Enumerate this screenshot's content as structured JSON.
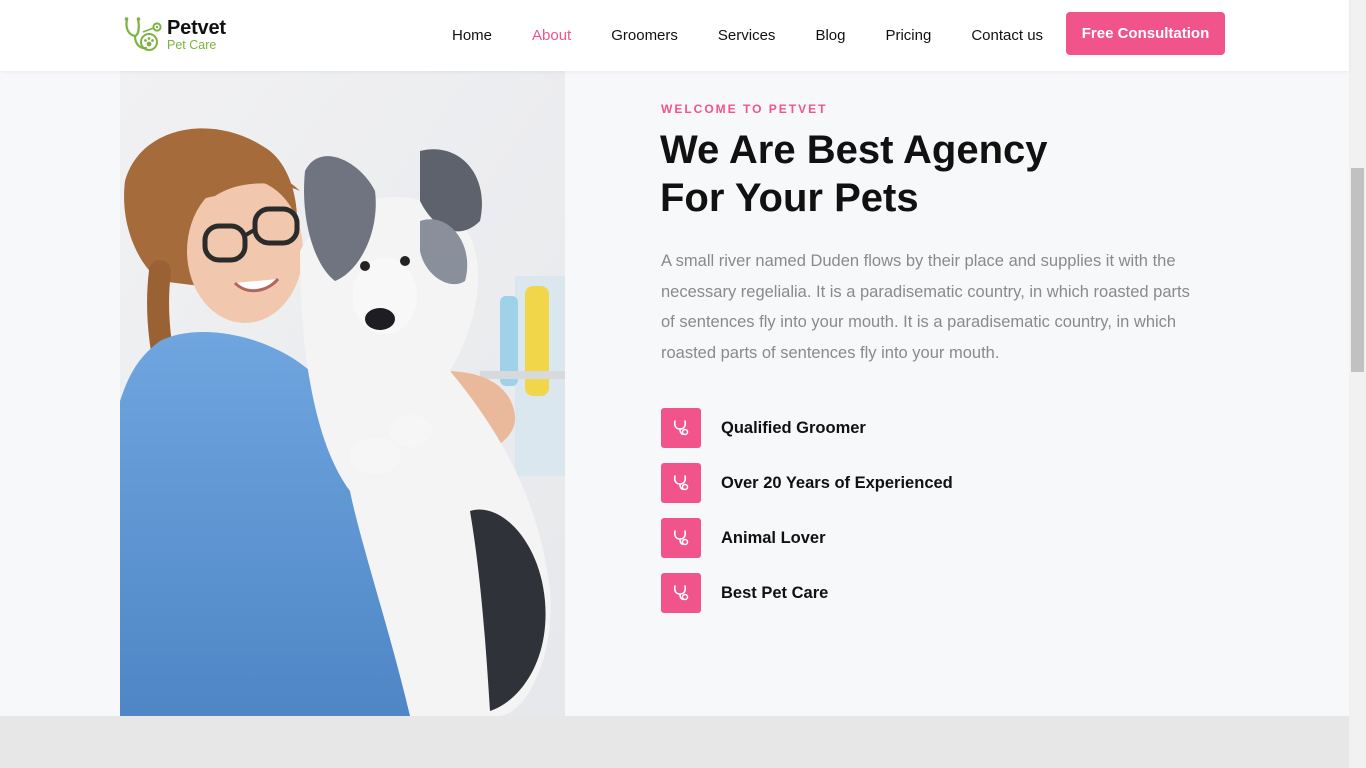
{
  "brand": {
    "name": "Petvet",
    "tagline": "Pet Care",
    "accent": "#f0548a",
    "logo_green": "#7cb342"
  },
  "nav": {
    "items": [
      {
        "label": "Home",
        "active": false
      },
      {
        "label": "About",
        "active": true
      },
      {
        "label": "Groomers",
        "active": false
      },
      {
        "label": "Services",
        "active": false
      },
      {
        "label": "Blog",
        "active": false
      },
      {
        "label": "Pricing",
        "active": false
      },
      {
        "label": "Contact us",
        "active": false
      }
    ],
    "cta_label": "Free Consultation"
  },
  "hero": {
    "eyebrow": "WELCOME TO PETVET",
    "headline_line1": "We Are Best Agency",
    "headline_line2": "For Your Pets",
    "paragraph": "A small river named Duden flows by their place and supplies it with the necessary regelialia. It is a paradisematic country, in which roasted parts of sentences fly into your mouth. It is a paradisematic country, in which roasted parts of sentences fly into your mouth.",
    "features": [
      {
        "label": "Qualified Groomer",
        "icon": "stethoscope-icon"
      },
      {
        "label": "Over 20 Years of Experienced",
        "icon": "stethoscope-icon"
      },
      {
        "label": "Animal Lover",
        "icon": "stethoscope-icon"
      },
      {
        "label": "Best Pet Care",
        "icon": "stethoscope-icon"
      }
    ]
  }
}
